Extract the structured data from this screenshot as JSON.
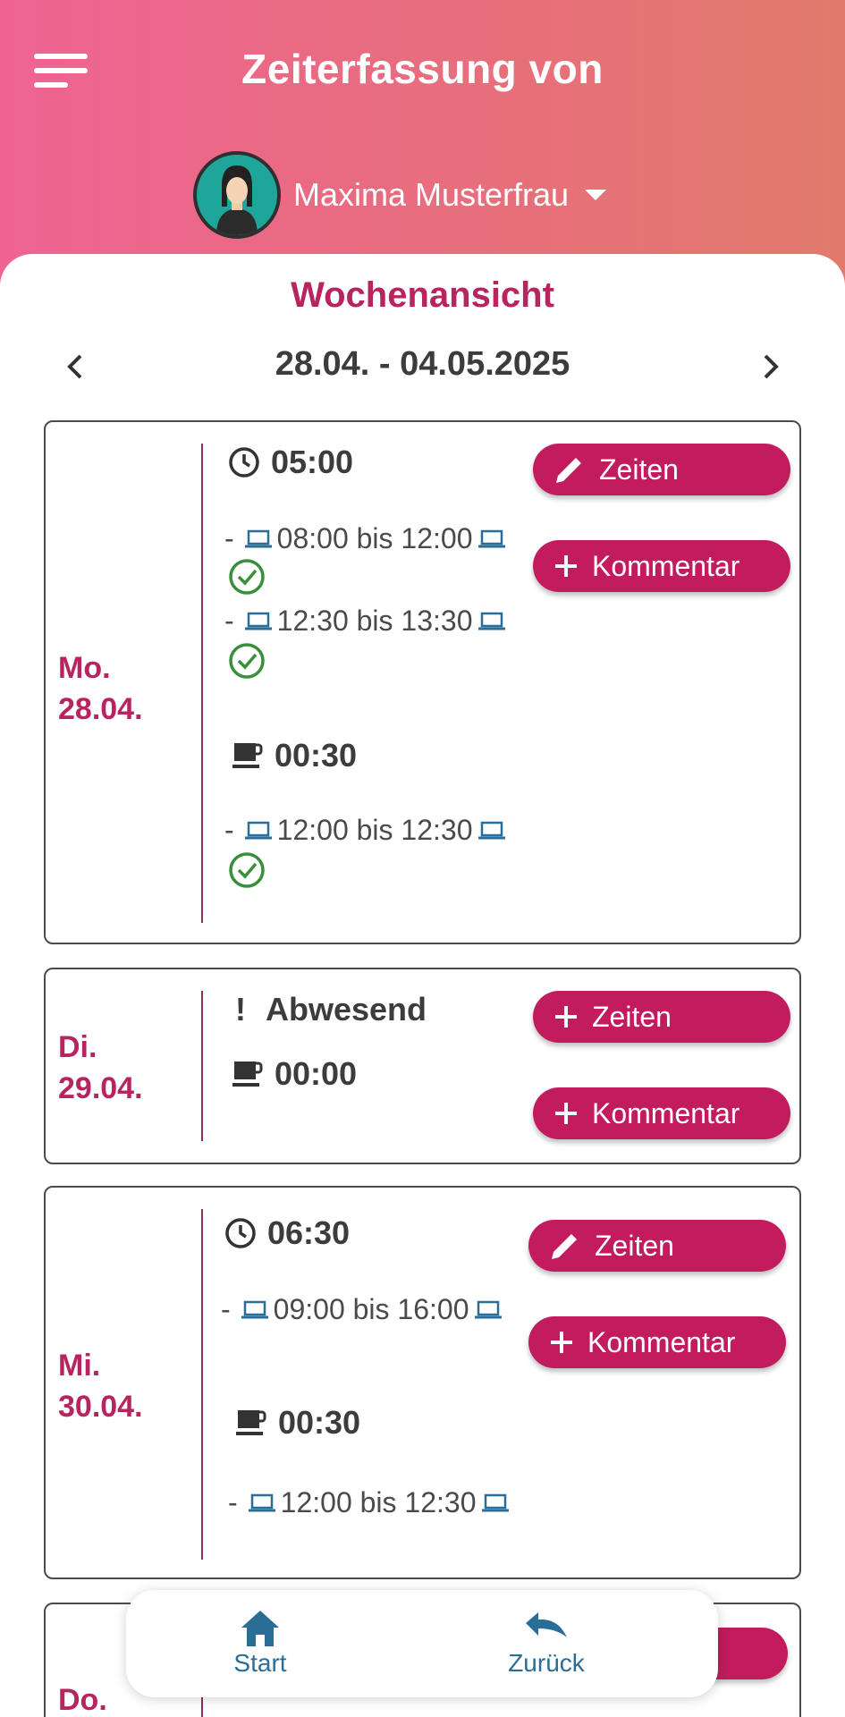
{
  "header": {
    "title": "Zeiterfassung von",
    "menu_icon": "hamburger-menu-icon",
    "user_name": "Maxima Musterfrau"
  },
  "week": {
    "title": "Wochenansicht",
    "range": "28.04. - 04.05.2025"
  },
  "colors": {
    "accent": "#c21c5e",
    "day_label": "#b7245f",
    "link_blue": "#2a6e98",
    "check_green": "#3a8f3a"
  },
  "days": [
    {
      "weekday": "Mo.",
      "date": "28.04.",
      "work_total": "05:00",
      "work_entries": [
        {
          "dash": "-",
          "text": "08:00 bis 12:00"
        },
        {
          "dash": "-",
          "text": "12:30 bis 13:30"
        }
      ],
      "break_total": "00:30",
      "break_entries": [
        {
          "dash": "-",
          "text": "12:00 bis 12:30"
        }
      ],
      "buttons": {
        "times": "Zeiten",
        "comment": "Kommentar"
      }
    },
    {
      "weekday": "Di.",
      "date": "29.04.",
      "status_mark": "!",
      "status": "Abwesend",
      "break_total": "00:00",
      "buttons": {
        "times": "Zeiten",
        "comment": "Kommentar"
      }
    },
    {
      "weekday": "Mi.",
      "date": "30.04.",
      "work_total": "06:30",
      "work_entries": [
        {
          "dash": "-",
          "text": "09:00 bis 16:00"
        }
      ],
      "break_total": "00:30",
      "break_entries": [
        {
          "dash": "-",
          "text": "12:00 bis 12:30"
        }
      ],
      "buttons": {
        "times": "Zeiten",
        "comment": "Kommentar"
      }
    },
    {
      "weekday": "Do."
    }
  ],
  "bottom_nav": {
    "start": "Start",
    "back": "Zurück"
  }
}
